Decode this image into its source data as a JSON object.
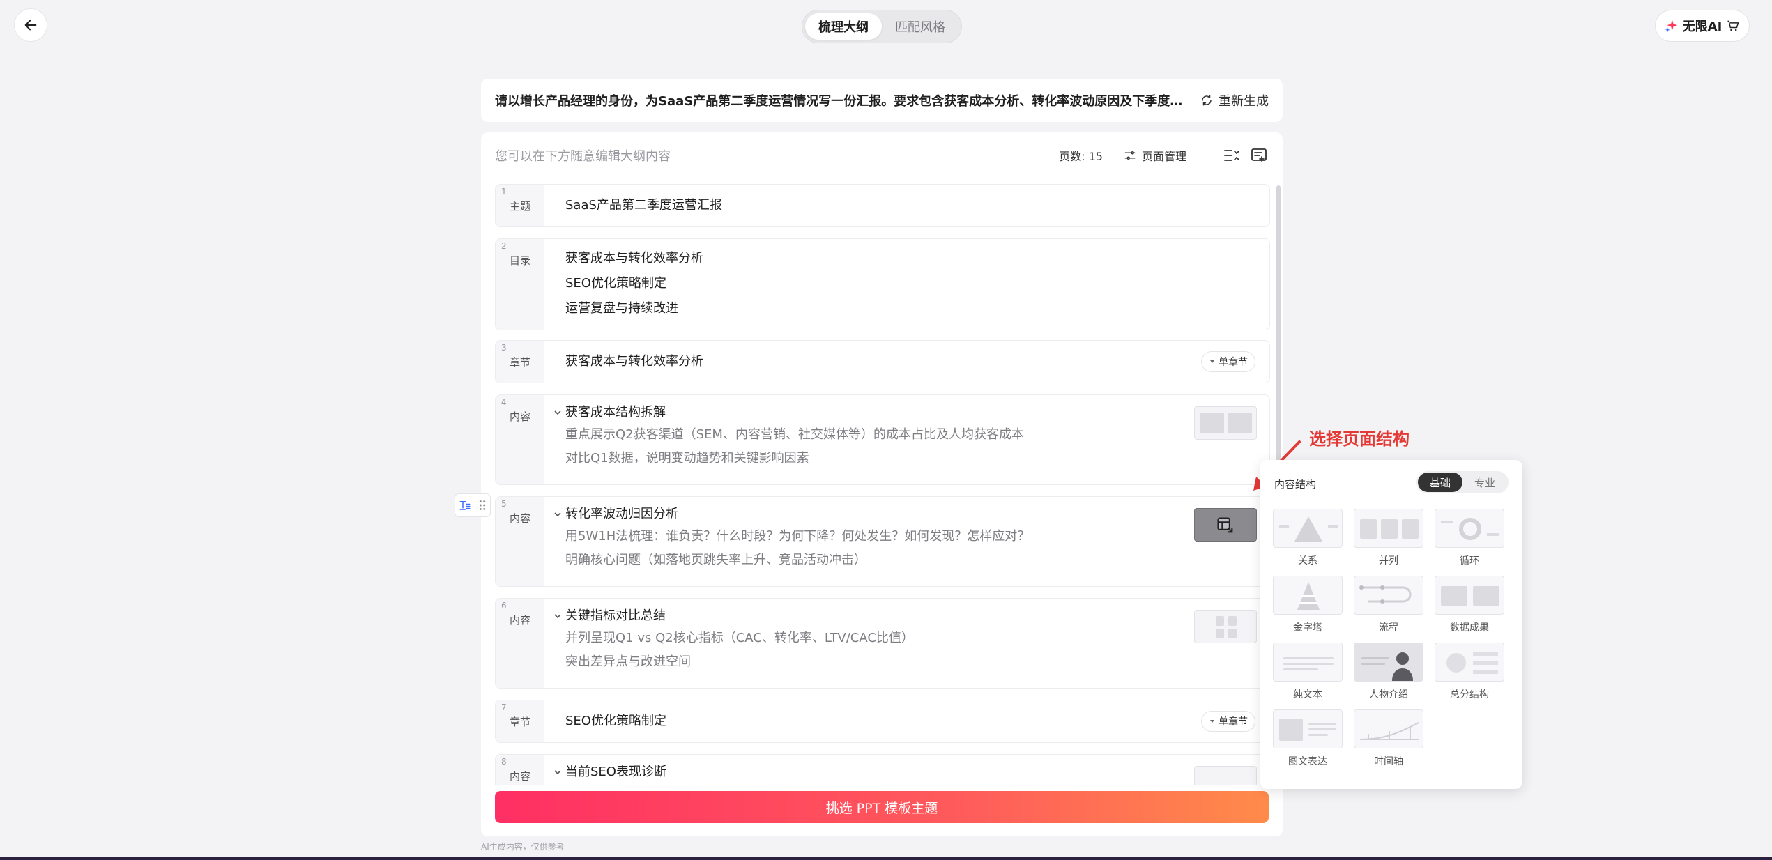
{
  "header": {
    "back_icon": "arrow-left-icon",
    "tabs": [
      {
        "label": "梳理大纲",
        "active": true
      },
      {
        "label": "匹配风格",
        "active": false
      }
    ],
    "vip_label": "无限AI"
  },
  "prompt": {
    "text": "请以增长产品经理的身份，为SaaS产品第二季度运营情况写一份汇报。要求包含获客成本分析、转化率波动原因及下季度SEO...",
    "regenerate_label": "重新生成"
  },
  "outline": {
    "hint": "您可以在下方随意编辑大纲内容",
    "page_count": "页数: 15",
    "page_manage_label": "页面管理",
    "cards": [
      {
        "num": "1",
        "tag": "主题",
        "lines": [
          "SaaS产品第二季度运营汇报"
        ]
      },
      {
        "num": "2",
        "tag": "目录",
        "lines": [
          "获客成本与转化效率分析",
          "SEO优化策略制定",
          "运营复盘与持续改进"
        ]
      },
      {
        "num": "3",
        "tag": "章节",
        "lines": [
          "获客成本与转化效率分析"
        ],
        "badge": "单章节"
      },
      {
        "num": "4",
        "tag": "内容",
        "title": "获客成本结构拆解",
        "subs": [
          "重点展示Q2获客渠道（SEM、内容营销、社交媒体等）的成本占比及人均获客成本",
          "对比Q1数据，说明变动趋势和关键影响因素"
        ]
      },
      {
        "num": "5",
        "tag": "内容",
        "title": "转化率波动归因分析",
        "subs": [
          "用5W1H法梳理：谁负责？什么时段？为何下降？何处发生？如何发现？怎样应对？",
          "明确核心问题（如落地页跳失率上升、竞品活动冲击）"
        ]
      },
      {
        "num": "6",
        "tag": "内容",
        "title": "关键指标对比总结",
        "subs": [
          "并列呈现Q1 vs Q2核心指标（CAC、转化率、LTV/CAC比值）",
          "突出差异点与改进空间"
        ]
      },
      {
        "num": "7",
        "tag": "章节",
        "lines": [
          "SEO优化策略制定"
        ],
        "badge": "单章节"
      },
      {
        "num": "8",
        "tag": "内容",
        "title": "当前SEO表现诊断"
      }
    ]
  },
  "cta_label": "挑选 PPT 模板主题",
  "footnote": "AI生成内容，仅供参考",
  "annotation": "选择页面结构",
  "structure_popover": {
    "title": "内容结构",
    "tabs": [
      {
        "label": "基础",
        "active": true
      },
      {
        "label": "专业",
        "active": false
      }
    ],
    "items": [
      "关系",
      "并列",
      "循环",
      "金字塔",
      "流程",
      "数据成果",
      "纯文本",
      "人物介绍",
      "总分结构",
      "图文表达",
      "时间轴"
    ]
  },
  "colors": {
    "accent_start": "#ff2f63",
    "accent_end": "#ff8b4a",
    "annotation": "#e53935"
  }
}
